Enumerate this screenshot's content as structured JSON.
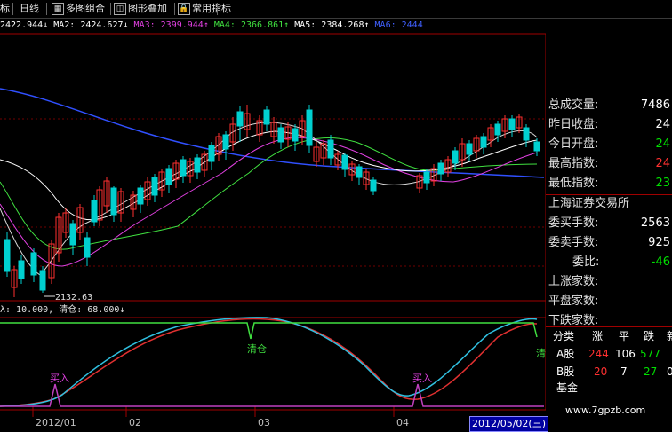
{
  "toolbar": {
    "items": [
      {
        "label": "标"
      },
      {
        "label": "日线"
      },
      {
        "label": "多图组合"
      },
      {
        "label": "图形叠加"
      },
      {
        "label": "常用指标"
      }
    ]
  },
  "ma_legend": {
    "ma1": "2422.944↓",
    "ma2": "MA2: 2424.627↓",
    "ma3": "MA3: 2399.944↑",
    "ma4": "MA4: 2366.861↑",
    "ma5": "MA5: 2384.268↑",
    "ma6": "MA6: 2444",
    "colors": {
      "ma1": "#ffffff",
      "ma2": "#ffffff",
      "ma3": "#e040e0",
      "ma4": "#40e040",
      "ma5": "#ffffff",
      "ma6": "#4060ff"
    }
  },
  "chart": {
    "low_label": "2132.63",
    "indicator_legend": "λ: 10.000, 清仓: 68.000↓",
    "ind_annotations": {
      "sell1": "清仓",
      "sell2": "清",
      "buy1": "买入",
      "buy2": "买入"
    }
  },
  "chart_data": {
    "type": "candlestick",
    "price_low_label": 2132.63,
    "axis_labels": [
      "2012/01",
      "02",
      "03",
      "04"
    ],
    "current_date": "2012/05/02(三)"
  },
  "panel": {
    "rows": [
      {
        "label": "总成交量:",
        "value": "7486",
        "color": "#ffffff"
      },
      {
        "label": "昨日收盘:",
        "value": "24",
        "color": "#ffffff"
      },
      {
        "label": "今日开盘:",
        "value": "24",
        "color": "#00e000"
      },
      {
        "label": "最高指数:",
        "value": "24",
        "color": "#ff3030"
      },
      {
        "label": "最低指数:",
        "value": "23",
        "color": "#00e000"
      },
      {
        "label": "上海证券交易所",
        "value": "",
        "color": "#ffffff"
      },
      {
        "label": "委买手数:",
        "value": "2563",
        "color": "#ffffff"
      },
      {
        "label": "委卖手数:",
        "value": "925",
        "color": "#ffffff"
      },
      {
        "label": "委比:",
        "value": "-46",
        "color": "#00e000"
      },
      {
        "label": "上涨家数:",
        "value": "",
        "color": "#ffffff"
      },
      {
        "label": "平盘家数:",
        "value": "",
        "color": "#ffffff"
      },
      {
        "label": "下跌家数:",
        "value": "",
        "color": "#ffffff"
      }
    ],
    "market_table": {
      "headers": [
        "分类",
        "涨",
        "平",
        "跌",
        "新"
      ],
      "rows": [
        {
          "name": "A股",
          "up": "244",
          "flat": "106",
          "down": "577",
          "new": ""
        },
        {
          "name": "B股",
          "up": "20",
          "flat": "7",
          "down": "27",
          "new": "0"
        },
        {
          "name": "基金",
          "up": "",
          "flat": "",
          "down": "",
          "new": ""
        }
      ]
    }
  },
  "watermark": "www.7gpzb.com"
}
